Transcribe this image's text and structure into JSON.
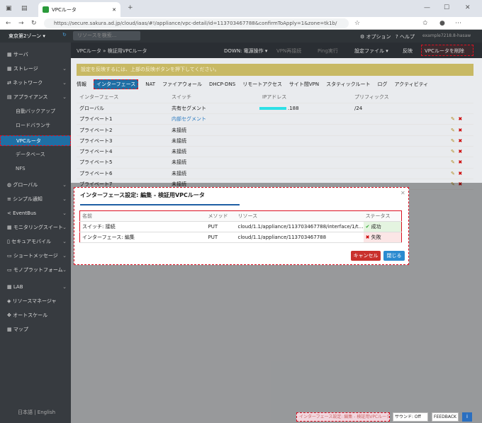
{
  "browser": {
    "tab_title": "VPCルータ",
    "url": "https://secure.sakura.ad.jp/cloud/iaas/#!/appliance/vpc-detail/id=113703467788&confirmToApply=1&zone=tk1b/"
  },
  "header": {
    "zone": "東京第2ゾーン ▾",
    "search_placeholder": "リソースを検索...",
    "options": "オプション",
    "help": "ヘルプ",
    "user": "example7218.8-hasaw"
  },
  "sidebar": {
    "items": [
      {
        "label": "サーバ",
        "sub": false,
        "chev": false
      },
      {
        "label": "ストレージ",
        "sub": false,
        "chev": true
      },
      {
        "label": "ネットワーク",
        "sub": false,
        "chev": true
      },
      {
        "label": "アプライアンス",
        "sub": false,
        "chev": true
      },
      {
        "label": "自動バックアップ",
        "sub": true,
        "chev": false
      },
      {
        "label": "ロードバランサ",
        "sub": true,
        "chev": false
      },
      {
        "label": "VPCルータ",
        "sub": true,
        "chev": false,
        "active": true
      },
      {
        "label": "データベース",
        "sub": true,
        "chev": false
      },
      {
        "label": "NFS",
        "sub": true,
        "chev": false
      },
      {
        "label": "グローバル",
        "sub": false,
        "chev": true
      },
      {
        "label": "シンプル通知",
        "sub": false,
        "chev": true
      },
      {
        "label": "EventBus",
        "sub": false,
        "chev": true
      },
      {
        "label": "モニタリングスイート",
        "sub": false,
        "chev": true
      },
      {
        "label": "セキュアモバイル",
        "sub": false,
        "chev": true
      },
      {
        "label": "ショートメッセージ",
        "sub": false,
        "chev": true
      },
      {
        "label": "モノプラットフォーム",
        "sub": false,
        "chev": true
      },
      {
        "label": "LAB",
        "sub": false,
        "chev": true
      },
      {
        "label": "リソースマネージャ",
        "sub": false,
        "chev": false
      },
      {
        "label": "オートスケール",
        "sub": false,
        "chev": false
      },
      {
        "label": "マップ",
        "sub": false,
        "chev": false
      }
    ],
    "lang": "日本語 | English"
  },
  "toolbar": {
    "crumb": "VPCルータ » 検証用VPCルータ",
    "down": "DOWN: 電源操作 ▾",
    "vpn": "VPN再接続",
    "ping": "Ping実行",
    "settings": "設定ファイル ▾",
    "apply": "反映",
    "delete": "VPCルータを削除"
  },
  "notice": "設定を反映するには、上部の反映ボタンを押下してください。",
  "tabs": [
    "情報",
    "インターフェース",
    "NAT",
    "ファイアウォール",
    "DHCP-DNS",
    "リモートアクセス",
    "サイト間VPN",
    "スタティックルート",
    "ログ",
    "アクティビティ"
  ],
  "iftable": {
    "headers": [
      "インターフェース",
      "スイッチ",
      "IPアドレス",
      "プリフィックス"
    ],
    "rows": [
      [
        "グローバル",
        "共有セグメント",
        ".188",
        "/24"
      ],
      [
        "プライベート1",
        "内部セグメント",
        "",
        ""
      ],
      [
        "プライベート2",
        "未接続",
        "",
        ""
      ],
      [
        "プライベート3",
        "未接続",
        "",
        ""
      ],
      [
        "プライベート4",
        "未接続",
        "",
        ""
      ],
      [
        "プライベート5",
        "未接続",
        "",
        ""
      ],
      [
        "プライベート6",
        "未接続",
        "",
        ""
      ],
      [
        "プライベート7",
        "未接続",
        "",
        ""
      ]
    ]
  },
  "modal": {
    "title": "インターフェース設定: 編集 - 検証用VPCルータ",
    "headers": [
      "名前",
      "メソッド",
      "リソース",
      "ステータス"
    ],
    "rows": [
      [
        "スイッチ: 接続",
        "PUT",
        "cloud/1.1/appliance/113703467788/interface/1/t…",
        "成功"
      ],
      [
        "インターフェース: 編集",
        "PUT",
        "cloud/1.1/appliance/113703467788",
        "失敗"
      ]
    ],
    "cancel": "キャンセル",
    "close": "閉じる"
  },
  "footer": {
    "task": "インターフェース設定: 編集 - 検証用VPCルータ",
    "sound": "サウンド: Off",
    "feedback": "FEEDBACK",
    "info": "i"
  }
}
